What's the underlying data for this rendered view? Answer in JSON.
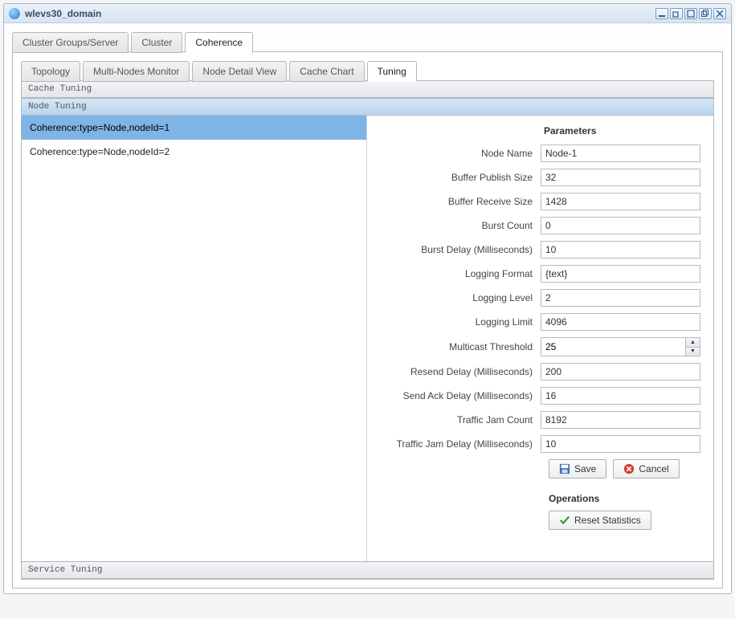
{
  "window": {
    "title": "wlevs30_domain"
  },
  "outer_tabs": [
    {
      "label": "Cluster Groups/Server",
      "active": false
    },
    {
      "label": "Cluster",
      "active": false
    },
    {
      "label": "Coherence",
      "active": true
    }
  ],
  "inner_tabs": [
    {
      "label": "Topology",
      "active": false
    },
    {
      "label": "Multi-Nodes Monitor",
      "active": false
    },
    {
      "label": "Node Detail View",
      "active": false
    },
    {
      "label": "Cache Chart",
      "active": false
    },
    {
      "label": "Tuning",
      "active": true
    }
  ],
  "accordion": {
    "cache": "Cache Tuning",
    "node": "Node Tuning",
    "service": "Service Tuning"
  },
  "nodes": [
    {
      "label": "Coherence:type=Node,nodeId=1",
      "selected": true
    },
    {
      "label": "Coherence:type=Node,nodeId=2",
      "selected": false
    }
  ],
  "parameters_title": "Parameters",
  "fields": {
    "node_name": {
      "label": "Node Name",
      "value": "Node-1"
    },
    "buffer_publish_size": {
      "label": "Buffer Publish Size",
      "value": "32"
    },
    "buffer_receive_size": {
      "label": "Buffer Receive Size",
      "value": "1428"
    },
    "burst_count": {
      "label": "Burst Count",
      "value": "0"
    },
    "burst_delay": {
      "label": "Burst Delay (Milliseconds)",
      "value": "10"
    },
    "logging_format": {
      "label": "Logging Format",
      "value": "{text}"
    },
    "logging_level": {
      "label": "Logging Level",
      "value": "2"
    },
    "logging_limit": {
      "label": "Logging Limit",
      "value": "4096"
    },
    "multicast_threshold": {
      "label": "Multicast Threshold",
      "value": "25"
    },
    "resend_delay": {
      "label": "Resend Delay (Milliseconds)",
      "value": "200"
    },
    "send_ack_delay": {
      "label": "Send Ack Delay (Milliseconds)",
      "value": "16"
    },
    "traffic_jam_count": {
      "label": "Traffic Jam Count",
      "value": "8192"
    },
    "traffic_jam_delay": {
      "label": "Traffic Jam Delay (Milliseconds)",
      "value": "10"
    }
  },
  "buttons": {
    "save": "Save",
    "cancel": "Cancel",
    "reset": "Reset Statistics"
  },
  "operations_title": "Operations"
}
